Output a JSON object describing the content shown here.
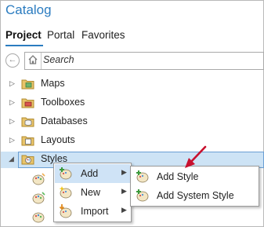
{
  "panel": {
    "title": "Catalog"
  },
  "tabs": [
    {
      "label": "Project"
    },
    {
      "label": "Portal"
    },
    {
      "label": "Favorites"
    }
  ],
  "search": {
    "placeholder": "Search"
  },
  "tree": [
    {
      "label": "Maps",
      "icon": "folder-maps-icon"
    },
    {
      "label": "Toolboxes",
      "icon": "folder-toolboxes-icon"
    },
    {
      "label": "Databases",
      "icon": "folder-databases-icon"
    },
    {
      "label": "Layouts",
      "icon": "folder-layouts-icon"
    },
    {
      "label": "Styles",
      "icon": "folder-styles-icon",
      "expanded": true,
      "selected": true
    }
  ],
  "context_menu": [
    {
      "label": "Add",
      "icon": "add-style-icon"
    },
    {
      "label": "New",
      "icon": "new-style-icon"
    },
    {
      "label": "Import",
      "icon": "import-style-icon"
    }
  ],
  "submenu": [
    {
      "label": "Add Style",
      "icon": "add-style-icon"
    },
    {
      "label": "Add System Style",
      "icon": "add-system-style-icon"
    }
  ],
  "colors": {
    "accent": "#2b7cc0",
    "selection": "#cde3f5",
    "annotation_arrow": "#c8102e"
  }
}
